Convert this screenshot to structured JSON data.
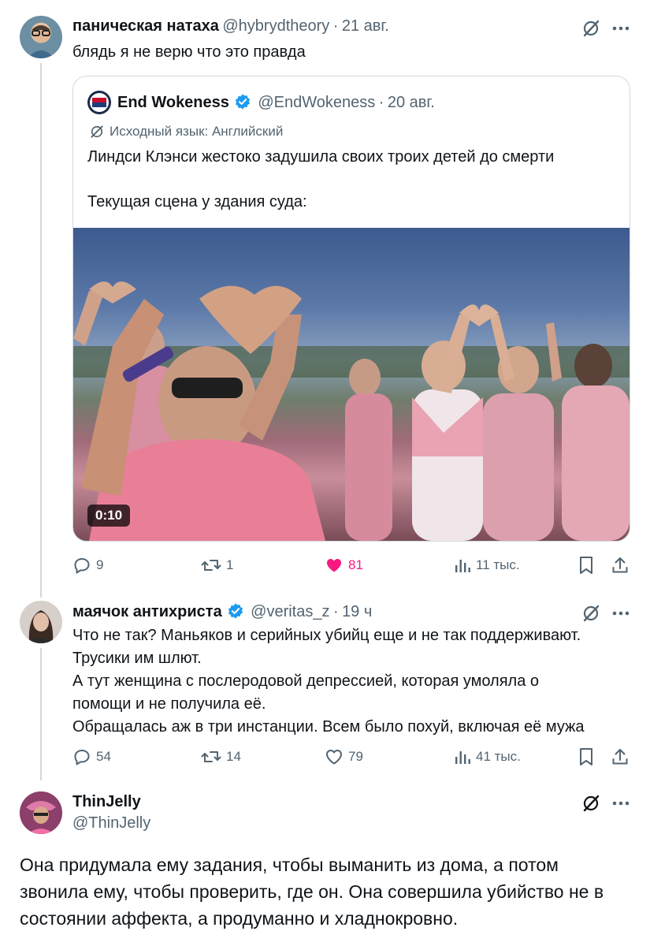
{
  "post1": {
    "display_name": "паническая натаха",
    "handle": "@hybrydtheory",
    "separator": "·",
    "date": "21 авг.",
    "text": "блядь я не верю что это правда",
    "quote": {
      "display_name": "End Wokeness",
      "handle": "@EndWokeness",
      "separator": "·",
      "date": "20 авг.",
      "translation_note": "Исходный язык: Английский",
      "text_line1": "Линдси Клэнси жестоко задушила своих троих детей до смерти",
      "text_line2": "Текущая сцена у здания суда:",
      "video_duration": "0:10"
    },
    "actions": {
      "replies": "9",
      "reposts": "1",
      "likes": "81",
      "views": "11 тыс."
    }
  },
  "post2": {
    "display_name": "маячок антихриста",
    "handle": "@veritas_z",
    "separator": "·",
    "date": "19 ч",
    "lines": [
      "Что не так? Маньяков и серийных убийц еще и не так поддерживают.",
      "Трусики им шлют.",
      "А тут женщина с послеродовой депрессией, которая умоляла о",
      "помощи и не получила её.",
      "Обращалась аж в три инстанции. Всем было похуй, включая её мужа"
    ],
    "actions": {
      "replies": "54",
      "reposts": "14",
      "likes": "79",
      "views": "41 тыс."
    }
  },
  "post3": {
    "display_name": "ThinJelly",
    "handle": "@ThinJelly",
    "lines": [
      "Она придумала ему задания, чтобы выманить из дома, а потом",
      "звонила ему, чтобы проверить, где он. Она совершила убийство не в",
      "состоянии аффекта, а продуманно и хладнокровно."
    ]
  },
  "colors": {
    "text_primary": "#0f1419",
    "text_secondary": "#536471",
    "verified_blue": "#1d9bf0",
    "like_pink": "#f91880",
    "border": "#cfd9de"
  },
  "icons": [
    "grok-icon",
    "more-icon",
    "verified-badge-icon",
    "translate-icon",
    "reply-icon",
    "repost-icon",
    "like-icon",
    "views-icon",
    "bookmark-icon",
    "share-icon"
  ]
}
